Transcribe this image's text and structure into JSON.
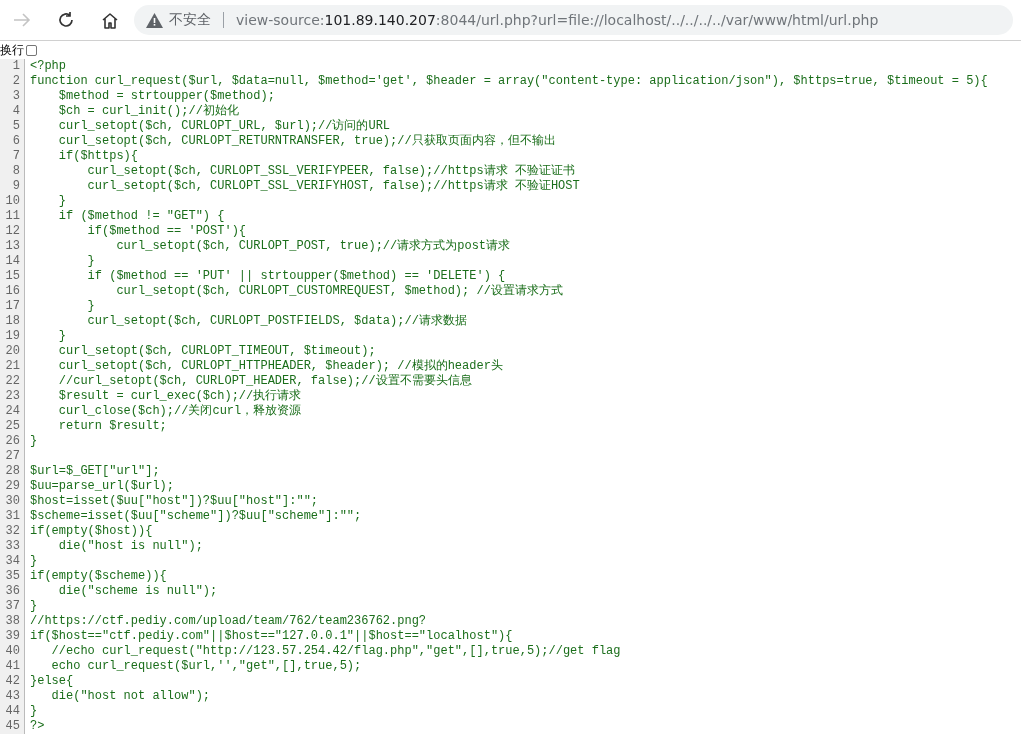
{
  "toolbar": {
    "security_label": "不安全",
    "url_parts": [
      {
        "text": "view-source:",
        "emphasis": false
      },
      {
        "text": "101.89.140.207",
        "emphasis": true
      },
      {
        "text": ":8044/url.php?url=file://localhost/../../../../var/www/html/url.php",
        "emphasis": false
      }
    ],
    "forward_disabled": true
  },
  "wrap": {
    "label": "换行",
    "checked": false
  },
  "lines": [
    {
      "number": "1",
      "code": "<?php"
    },
    {
      "number": "2",
      "code": "function curl_request($url, $data=null, $method='get', $header = array(\"content-type: application/json\"), $https=true, $timeout = 5){"
    },
    {
      "number": "3",
      "code": "    $method = strtoupper($method);"
    },
    {
      "number": "4",
      "code": "    $ch = curl_init();//初始化"
    },
    {
      "number": "5",
      "code": "    curl_setopt($ch, CURLOPT_URL, $url);//访问的URL"
    },
    {
      "number": "6",
      "code": "    curl_setopt($ch, CURLOPT_RETURNTRANSFER, true);//只获取页面内容，但不输出"
    },
    {
      "number": "7",
      "code": "    if($https){"
    },
    {
      "number": "8",
      "code": "        curl_setopt($ch, CURLOPT_SSL_VERIFYPEER, false);//https请求 不验证证书"
    },
    {
      "number": "9",
      "code": "        curl_setopt($ch, CURLOPT_SSL_VERIFYHOST, false);//https请求 不验证HOST"
    },
    {
      "number": "10",
      "code": "    }"
    },
    {
      "number": "11",
      "code": "    if ($method != \"GET\") {"
    },
    {
      "number": "12",
      "code": "        if($method == 'POST'){"
    },
    {
      "number": "13",
      "code": "            curl_setopt($ch, CURLOPT_POST, true);//请求方式为post请求"
    },
    {
      "number": "14",
      "code": "        }"
    },
    {
      "number": "15",
      "code": "        if ($method == 'PUT' || strtoupper($method) == 'DELETE') {"
    },
    {
      "number": "16",
      "code": "            curl_setopt($ch, CURLOPT_CUSTOMREQUEST, $method); //设置请求方式"
    },
    {
      "number": "17",
      "code": "        }"
    },
    {
      "number": "18",
      "code": "        curl_setopt($ch, CURLOPT_POSTFIELDS, $data);//请求数据"
    },
    {
      "number": "19",
      "code": "    }"
    },
    {
      "number": "20",
      "code": "    curl_setopt($ch, CURLOPT_TIMEOUT, $timeout);"
    },
    {
      "number": "21",
      "code": "    curl_setopt($ch, CURLOPT_HTTPHEADER, $header); //模拟的header头"
    },
    {
      "number": "22",
      "code": "    //curl_setopt($ch, CURLOPT_HEADER, false);//设置不需要头信息"
    },
    {
      "number": "23",
      "code": "    $result = curl_exec($ch);//执行请求"
    },
    {
      "number": "24",
      "code": "    curl_close($ch);//关闭curl，释放资源"
    },
    {
      "number": "25",
      "code": "    return $result;"
    },
    {
      "number": "26",
      "code": "}"
    },
    {
      "number": "27"
    },
    {
      "number": "28",
      "code": "$url=$_GET[\"url\"];"
    },
    {
      "number": "29",
      "code": "$uu=parse_url($url);"
    },
    {
      "number": "30",
      "code": "$host=isset($uu[\"host\"])?$uu[\"host\"]:\"\";"
    },
    {
      "number": "31",
      "code": "$scheme=isset($uu[\"scheme\"])?$uu[\"scheme\"]:\"\";"
    },
    {
      "number": "32",
      "code": "if(empty($host)){"
    },
    {
      "number": "33",
      "code": "    die(\"host is null\");"
    },
    {
      "number": "34",
      "code": "}"
    },
    {
      "number": "35",
      "code": "if(empty($scheme)){"
    },
    {
      "number": "36",
      "code": "    die(\"scheme is null\");"
    },
    {
      "number": "37",
      "code": "}"
    },
    {
      "number": "38",
      "code": "//https://ctf.pediy.com/upload/team/762/team236762.png?"
    },
    {
      "number": "39",
      "code": "if($host==\"ctf.pediy.com\"||$host==\"127.0.0.1\"||$host==\"localhost\"){"
    },
    {
      "number": "40",
      "code": "   //echo curl_request(\"http://123.57.254.42/flag.php\",\"get\",[],true,5);//get flag"
    },
    {
      "number": "41",
      "code": "   echo curl_request($url,'',\"get\",[],true,5);"
    },
    {
      "number": "42",
      "code": "}else{"
    },
    {
      "number": "43",
      "code": "   die(\"host not allow\");"
    },
    {
      "number": "44",
      "code": "}"
    },
    {
      "number": "45",
      "code": "?>"
    }
  ]
}
